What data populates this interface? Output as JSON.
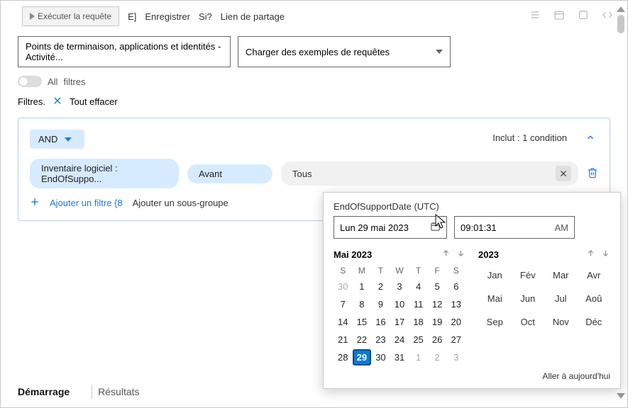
{
  "toolbar": {
    "run": "Exécuter la requête",
    "save_prefix": "E]",
    "save": "Enregistrer",
    "si": "Si?",
    "share": "Lien de partage"
  },
  "dropdowns": {
    "scope": "Points de terminaison, applications et identités - Activité...",
    "examples": "Charger des exemples de requêtes"
  },
  "toggles": {
    "all": "All",
    "filters_word": "filtres"
  },
  "filters_row": {
    "label": "Filtres.",
    "clear": "Tout effacer"
  },
  "filter": {
    "and": "AND",
    "includes": "Inclut : 1 condition",
    "field_pill": "Inventaire logiciel : EndOfSuppo...",
    "op_pill": "Avant",
    "value_pill": "Tous",
    "add_filter": "Ajouter un filtre {8",
    "add_subgroup": "Ajouter un sous-groupe"
  },
  "popover": {
    "label": "EndOfSupportDate (UTC)",
    "date_text": "Lun 29 mai 2023",
    "time_text": "09:01:31",
    "ampm": "AM",
    "month_title": "Mai 2023",
    "year_title": "2023",
    "dow": [
      "S",
      "M",
      "T",
      "W",
      "T",
      "F",
      "S"
    ],
    "today": "Aller à aujourd'hui",
    "months": [
      "Jan",
      "Fév",
      "Mar",
      "Avr",
      "Mai",
      "Jun",
      "Jul",
      "Aoû",
      "Sep",
      "Oct",
      "Nov",
      "Déc"
    ]
  },
  "tabs": {
    "start": "Démarrage",
    "results": "Résultats"
  },
  "chart_data": {
    "type": "table",
    "note": "Calendar grid — May 2023 with 29 selected",
    "columns": [
      "S",
      "M",
      "T",
      "W",
      "T",
      "F",
      "S"
    ],
    "rows": [
      [
        30,
        1,
        2,
        3,
        4,
        5,
        6
      ],
      [
        7,
        8,
        9,
        10,
        11,
        12,
        13
      ],
      [
        14,
        15,
        16,
        17,
        18,
        19,
        20
      ],
      [
        21,
        22,
        23,
        24,
        25,
        26,
        27
      ],
      [
        28,
        29,
        30,
        31,
        1,
        2,
        3
      ]
    ],
    "selected": 29,
    "leading_muted": [
      30
    ],
    "trailing_muted": [
      1,
      2,
      3
    ]
  }
}
